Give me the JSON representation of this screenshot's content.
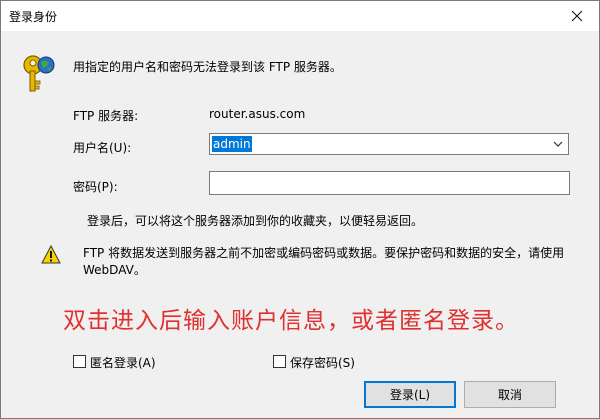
{
  "window": {
    "title": "登录身份"
  },
  "intro": "用指定的用户名和密码无法登录到该 FTP 服务器。",
  "server": {
    "label": "FTP 服务器:",
    "value": "router.asus.com"
  },
  "username": {
    "label": "用户名(U):",
    "value": "admin"
  },
  "password": {
    "label": "密码(P):",
    "value": ""
  },
  "note": "登录后，可以将这个服务器添加到你的收藏夹，以便轻易返回。",
  "warning": "FTP 将数据发送到服务器之前不加密或编码密码或数据。要保护密码和数据的安全，请使用 WebDAV。",
  "overlay_text": "双击进入后输入账户信息，或者匿名登录。",
  "checkboxes": {
    "anonymous": "匿名登录(A)",
    "save_password": "保存密码(S)"
  },
  "buttons": {
    "login": "登录(L)",
    "cancel": "取消"
  },
  "icons": {
    "key": "key-icon",
    "warning": "warning-icon",
    "close": "close-icon",
    "dropdown": "chevron-down-icon"
  },
  "colors": {
    "accent": "#0078d7",
    "overlay_text": "#e0302f",
    "warning_yellow": "#f7d200"
  }
}
